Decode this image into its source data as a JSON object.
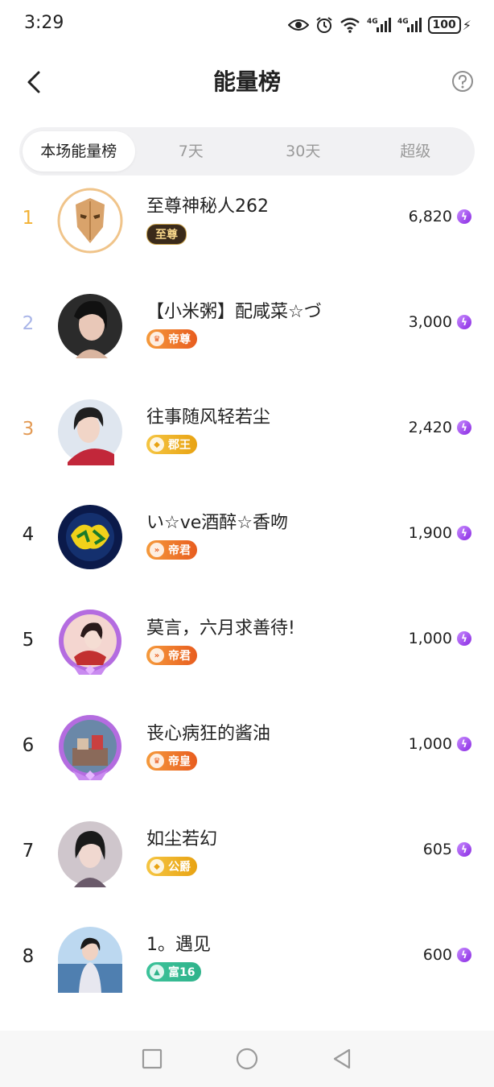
{
  "status_bar": {
    "time": "3:29",
    "battery": "100",
    "network_a": "4G",
    "network_b": "4G"
  },
  "header": {
    "title": "能量榜"
  },
  "tabs": [
    {
      "label": "本场能量榜",
      "active": true
    },
    {
      "label": "7天",
      "active": false
    },
    {
      "label": "30天",
      "active": false
    },
    {
      "label": "超级",
      "active": false
    }
  ],
  "ranking": [
    {
      "rank": "1",
      "name": "至尊神秘人262",
      "badge": "至尊",
      "score": "6,820",
      "rank_color": "#f2b134"
    },
    {
      "rank": "2",
      "name": "【小米粥】配咸菜☆づ",
      "badge": "帝尊",
      "score": "3,000",
      "rank_color": "#a9b5e8"
    },
    {
      "rank": "3",
      "name": "往事随风轻若尘",
      "badge": "郡王",
      "score": "2,420",
      "rank_color": "#e39a54"
    },
    {
      "rank": "4",
      "name": "い☆ve酒醉☆香吻",
      "badge": "帝君",
      "score": "1,900",
      "rank_color": "#222222"
    },
    {
      "rank": "5",
      "name": "莫言，六月求善待!",
      "badge": "帝君",
      "score": "1,000",
      "rank_color": "#222222"
    },
    {
      "rank": "6",
      "name": "丧心病狂的酱油",
      "badge": "帝皇",
      "score": "1,000",
      "rank_color": "#222222"
    },
    {
      "rank": "7",
      "name": "如尘若幻",
      "badge": "公爵",
      "score": "605",
      "rank_color": "#222222"
    },
    {
      "rank": "8",
      "name": "1。遇见",
      "badge": "富16",
      "score": "600",
      "rank_color": "#222222"
    }
  ],
  "colors": {
    "energy": "#8a2be2",
    "badge_orange": "#f07a2a",
    "badge_gold": "#f0b21a",
    "badge_green": "#2fb38b",
    "badge_dark": "#3a2a1a"
  },
  "icons": {
    "back": "back-arrow-icon",
    "help": "question-mark-icon",
    "energy": "lightning-icon"
  }
}
